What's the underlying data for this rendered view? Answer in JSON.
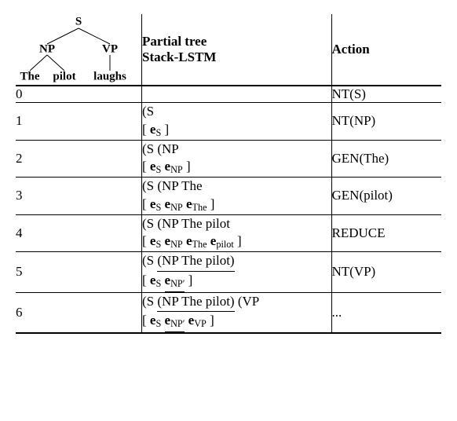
{
  "header": {
    "mid_line1": "Partial tree",
    "mid_line2": "Stack-LSTM",
    "action": "Action"
  },
  "tree": {
    "root": "S",
    "np": "NP",
    "vp": "VP",
    "leaf_the": "The",
    "leaf_pilot": "pilot",
    "leaf_laughs": "laughs"
  },
  "rows": [
    {
      "num": "0",
      "partial_tree": "",
      "stack": [],
      "action": "NT(S)"
    },
    {
      "num": "1",
      "partial_tree": "(S",
      "stack": [
        {
          "t": "e",
          "sub": "S"
        }
      ],
      "action": "NT(NP)"
    },
    {
      "num": "2",
      "partial_tree": "(S (NP",
      "stack": [
        {
          "t": "e",
          "sub": "S"
        },
        {
          "t": "e",
          "sub": "NP"
        }
      ],
      "action": "GEN(The)"
    },
    {
      "num": "3",
      "partial_tree": "(S (NP The",
      "stack": [
        {
          "t": "e",
          "sub": "S"
        },
        {
          "t": "e",
          "sub": "NP"
        },
        {
          "t": "e",
          "sub": "The"
        }
      ],
      "action": "GEN(pilot)"
    },
    {
      "num": "4",
      "partial_tree": "(S (NP The pilot",
      "stack": [
        {
          "t": "e",
          "sub": "S"
        },
        {
          "t": "e",
          "sub": "NP"
        },
        {
          "t": "e",
          "sub": "The"
        },
        {
          "t": "e",
          "sub": "pilot"
        }
      ],
      "action": "REDUCE"
    },
    {
      "num": "5",
      "pt_segments": [
        {
          "text": "(S ",
          "comp": false
        },
        {
          "text": "(NP The pilot)",
          "comp": true
        }
      ],
      "stack": [
        {
          "t": "e",
          "sub": "S"
        },
        {
          "t": "e",
          "sub": "NP′",
          "comp": true
        }
      ],
      "action": "NT(VP)"
    },
    {
      "num": "6",
      "pt_segments": [
        {
          "text": "(S ",
          "comp": false
        },
        {
          "text": "(NP The pilot)",
          "comp": true
        },
        {
          "text": " (VP",
          "comp": false
        }
      ],
      "stack": [
        {
          "t": "e",
          "sub": "S"
        },
        {
          "t": "e",
          "sub": "NP′",
          "comp": true
        },
        {
          "t": "e",
          "sub": "VP"
        }
      ],
      "action": "..."
    }
  ]
}
